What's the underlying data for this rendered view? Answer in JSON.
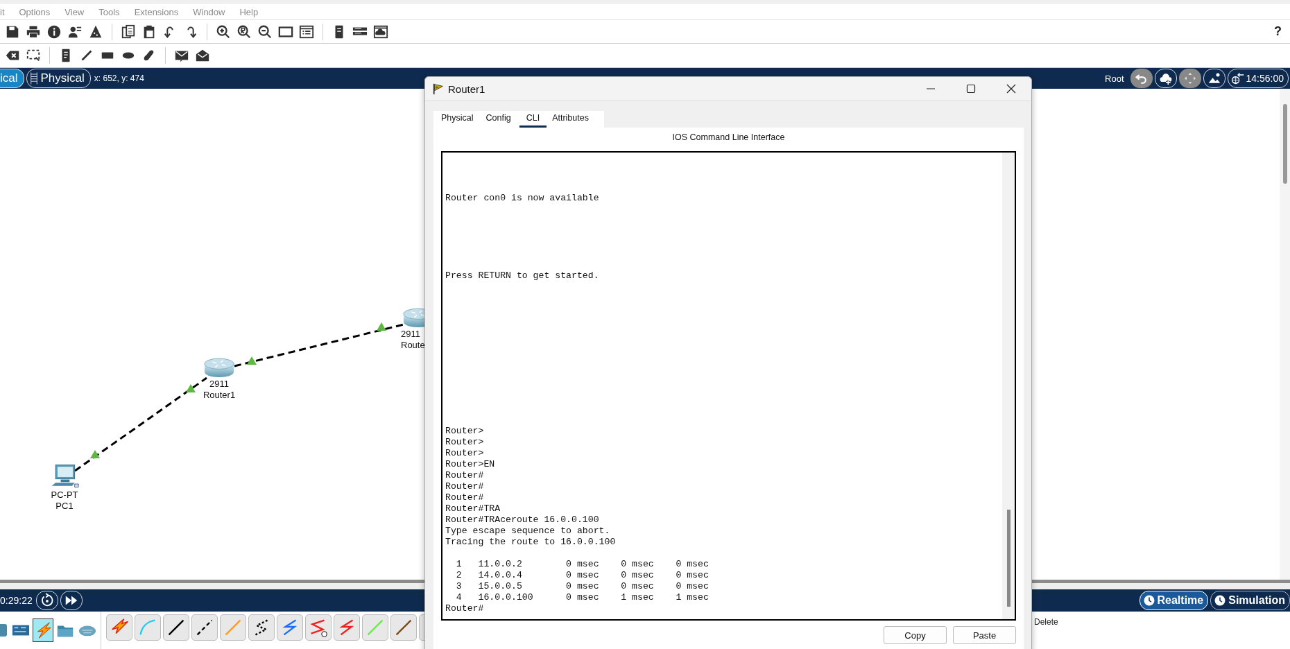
{
  "menu_bar": {
    "items": [
      "it",
      "Options",
      "View",
      "Tools",
      "Extensions",
      "Window",
      "Help"
    ]
  },
  "toolbar": {
    "help": "?"
  },
  "workspace_bar": {
    "tabs": [
      {
        "label": "ical",
        "selected": true
      },
      {
        "label": "Physical",
        "selected": false
      }
    ],
    "coordinates": "x: 652, y: 474",
    "root": "Root",
    "clock": "14:56:00"
  },
  "canvas": {
    "devices": [
      {
        "kind": "pc",
        "model": "PC-PT",
        "name": "PC1"
      },
      {
        "kind": "router",
        "model": "2911",
        "name": "Router1"
      },
      {
        "kind": "router",
        "model": "2911",
        "name": "Route"
      }
    ]
  },
  "dialog": {
    "title": "Router1",
    "tabs": [
      {
        "label": "Physical",
        "selected": false
      },
      {
        "label": "Config",
        "selected": false
      },
      {
        "label": "CLI",
        "selected": true
      },
      {
        "label": "Attributes",
        "selected": false
      }
    ],
    "heading": "IOS Command Line Interface",
    "output": "Router con0 is now available\n\n\n\n\n\n\nPress RETURN to get started.\n\n\n\n\n\n\n\n\n\n\n\n\n\nRouter>\nRouter>\nRouter>\nRouter>EN\nRouter#\nRouter#\nRouter#\nRouter#TRA\nRouter#TRAceroute 16.0.0.100\nType escape sequence to abort.\nTracing the route to 16.0.0.100\n\n  1   11.0.0.2        0 msec    0 msec    0 msec\n  2   14.0.0.4        0 msec    0 msec    0 msec\n  3   15.0.0.5        0 msec    0 msec    0 msec\n  4   16.0.0.100      0 msec    1 msec    1 msec\nRouter#",
    "buttons": [
      "Copy",
      "Paste"
    ]
  },
  "simulation_bar": {
    "time": "0:29:22",
    "modes": [
      {
        "label": "Realtime",
        "selected": true
      },
      {
        "label": "Simulation",
        "selected": false
      }
    ]
  },
  "device_panel": {
    "categories": [
      {
        "kind": "switch",
        "selected": false
      },
      {
        "kind": "board",
        "selected": false
      },
      {
        "kind": "connection",
        "selected": true
      },
      {
        "kind": "folder",
        "selected": false
      },
      {
        "kind": "cloud",
        "selected": false
      }
    ]
  },
  "properties_panel": {
    "action": "Delete"
  }
}
